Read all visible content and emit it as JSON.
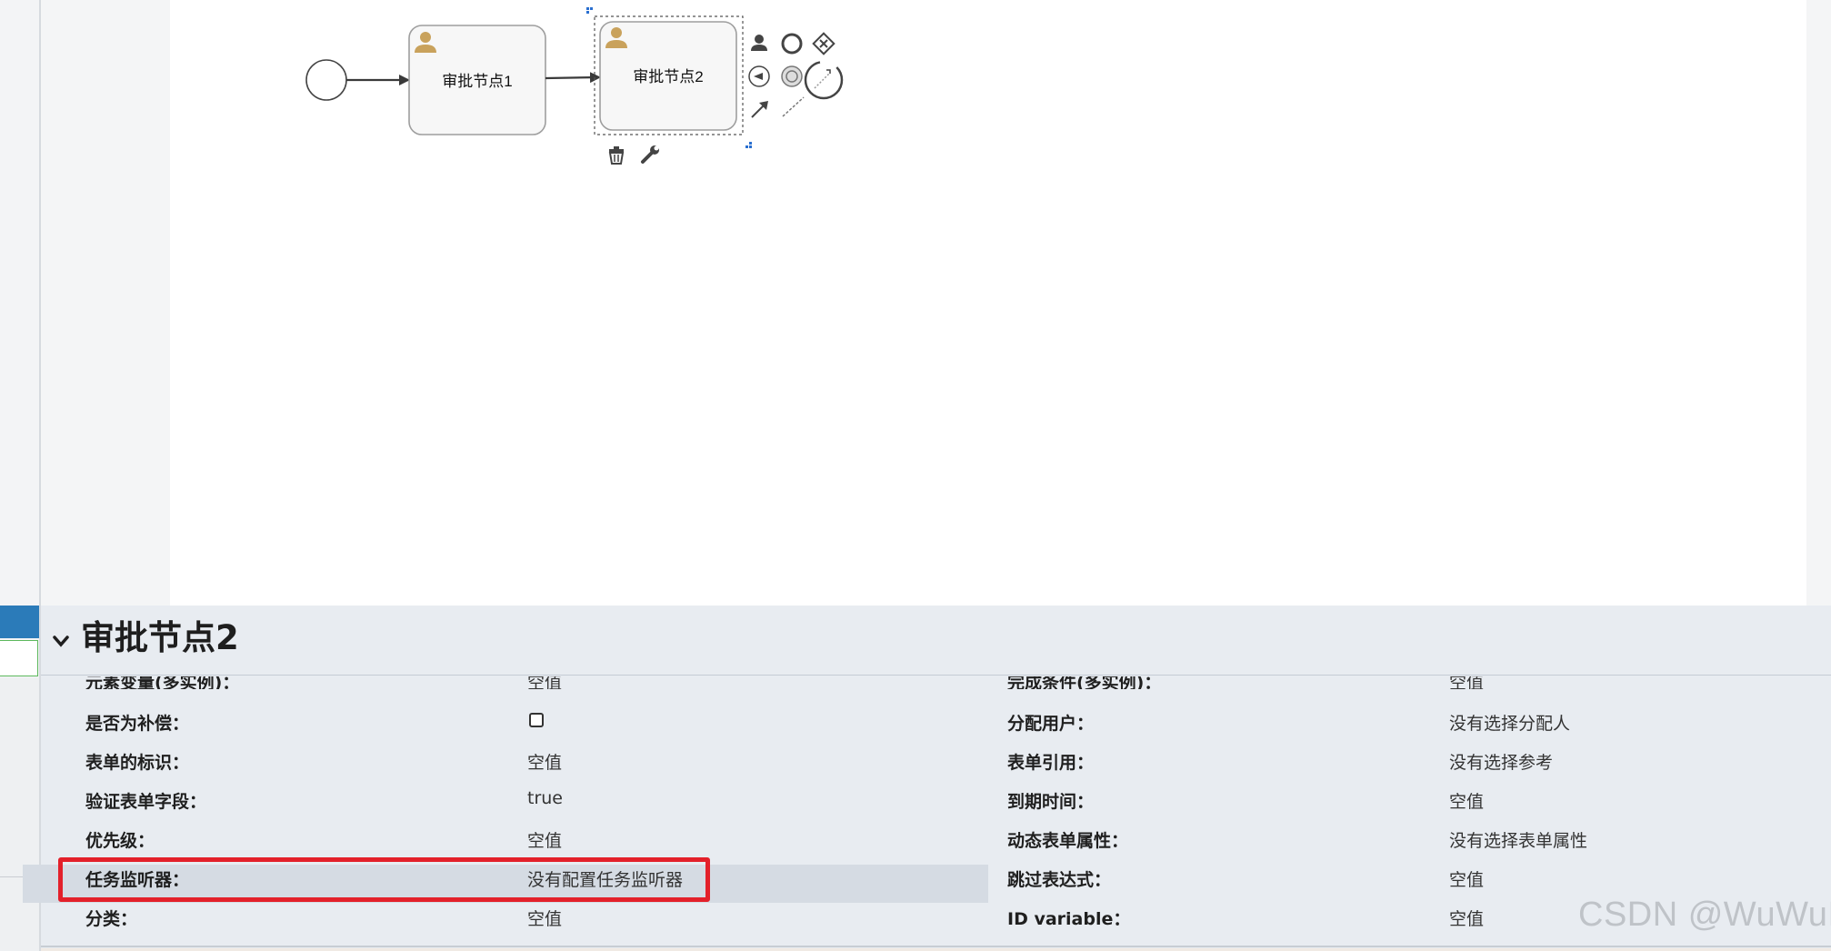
{
  "diagram": {
    "task1_label": "审批节点1",
    "task2_label": "审批节点2"
  },
  "panel": {
    "title": "审批节点2",
    "rows": [
      {
        "left_label": "元素变量(多实例)：",
        "left_value": "空值",
        "right_label": "完成条件(多实例)：",
        "right_value": "空值"
      },
      {
        "left_label": "是否为补偿：",
        "left_value": "",
        "right_label": "分配用户：",
        "right_value": "没有选择分配人"
      },
      {
        "left_label": "表单的标识：",
        "left_value": "空值",
        "right_label": "表单引用：",
        "right_value": "没有选择参考"
      },
      {
        "left_label": "验证表单字段：",
        "left_value": "true",
        "right_label": "到期时间：",
        "right_value": "空值"
      },
      {
        "left_label": "优先级：",
        "left_value": "空值",
        "right_label": "动态表单属性：",
        "right_value": "没有选择表单属性"
      },
      {
        "left_label": "任务监听器：",
        "left_value": "没有配置任务监听器",
        "right_label": "跳过表达式：",
        "right_value": "空值"
      },
      {
        "left_label": "分类：",
        "left_value": "空值",
        "right_label": "ID variable：",
        "right_value": "空值"
      }
    ]
  },
  "watermark": "CSDN @WuWuII",
  "colors": {
    "highlight_border": "#e3202a",
    "user_icon": "#c9a25c",
    "panel_bg": "#e8ecf1"
  }
}
